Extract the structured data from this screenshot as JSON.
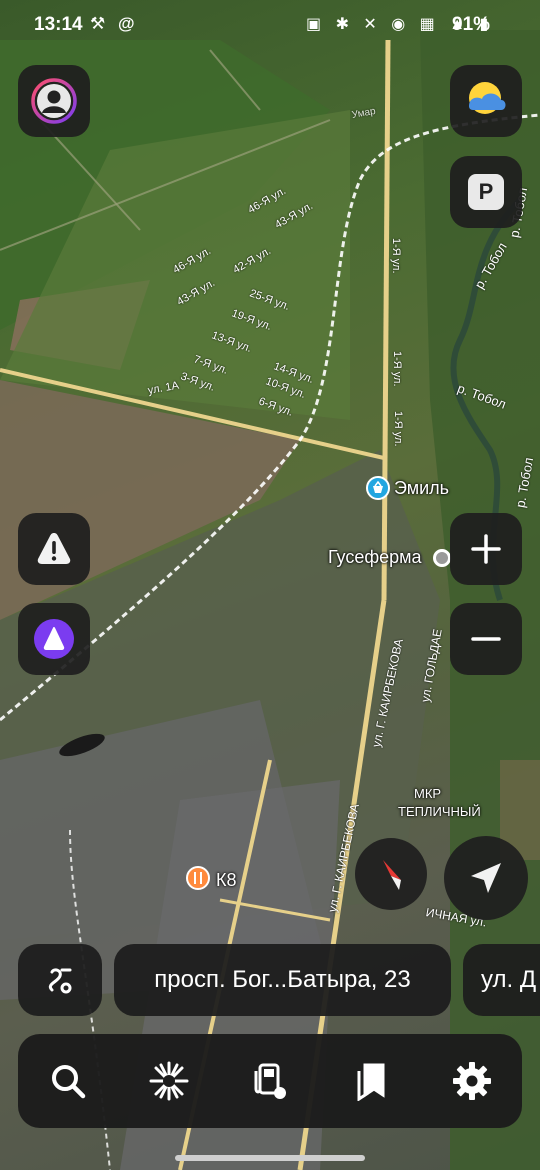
{
  "status_bar": {
    "time": "13:14",
    "left_icons": "⚒ @",
    "right_icons": "▣ ✱ ✕ ◉ ▦ ▲ ▮",
    "battery": "91%"
  },
  "map": {
    "places": {
      "emil": "Эмиль",
      "guseferma": "Гусеферма",
      "mkr_line1": "МКР",
      "mkr_line2": "ТЕПЛИЧНЫЙ",
      "k8": "К8"
    },
    "streets": {
      "s46a": "46-Я ул.",
      "s43a": "43-Я ул.",
      "s46b": "46-Я ул.",
      "s42": "42-Я ул.",
      "s43b": "43-Я ул.",
      "s25": "25-Я ул.",
      "s19": "19-Я ул.",
      "s13": "13-Я ул.",
      "s14": "14-Я ул.",
      "s7": "7-Я ул.",
      "s10": "10-Я ул.",
      "s3": "3-Я ул.",
      "s6": "6-Я ул.",
      "s1a": "ул. 1А",
      "s1_1": "1-Я ул.",
      "s1_2": "1-Я ул.",
      "s1_3": "1-Я ул.",
      "kairbekova1": "ул. Г. КАИРБЕКОВА",
      "kairbekova2": "ул. Г. КАИРБЕКОВА",
      "golda": "ул. ГОЛЬДАЕ",
      "tobol1": "р. Тобол",
      "tobol2": "р. Тобол",
      "tobol3": "р. Тобол",
      "tobol4": "р. Тобол",
      "ichnaya": "ИЧНАЯ ул.",
      "umar": "Умар"
    }
  },
  "address_bar": {
    "current": "просп. Бог...Батыра, 23",
    "next": "ул. Д"
  },
  "colors": {
    "accent_purple": "#7b3cf0",
    "nav_red": "#e53935",
    "road": "#e6d08a"
  },
  "icons": {
    "profile": "profile-avatar-icon",
    "weather": "weather-icon",
    "parking": "P"
  }
}
